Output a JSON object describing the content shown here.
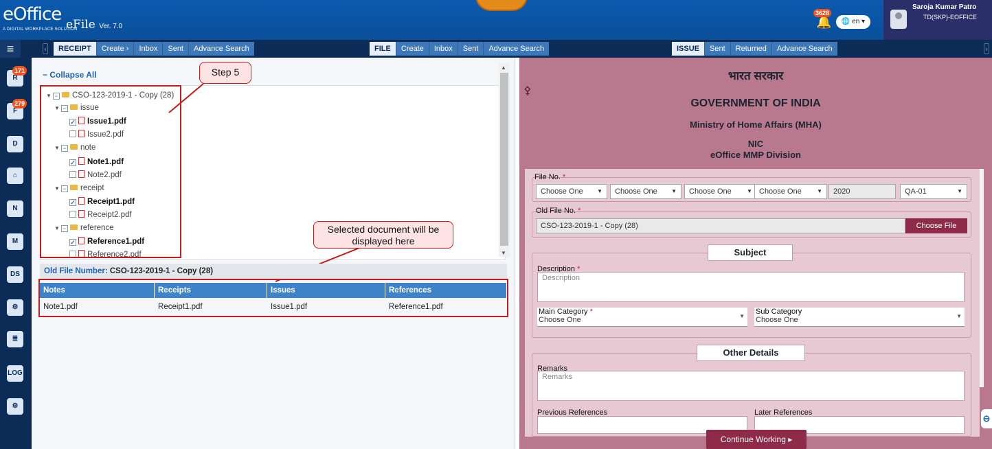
{
  "header": {
    "brand": "eOffice",
    "tagline": "A DIGITAL WORKPLACE SOLUTION",
    "app_name": "eFile",
    "version": "Ver. 7.0",
    "notification_count": "3628",
    "language": "en",
    "user_name": "Saroja Kumar Patro",
    "user_role": "TD(SKP)-EOFFICE"
  },
  "toolbar": {
    "receipt": {
      "title": "RECEIPT",
      "links": [
        "Create ›",
        "Inbox",
        "Sent",
        "Advance Search"
      ]
    },
    "file": {
      "title": "FILE",
      "links": [
        "Create",
        "Inbox",
        "Sent",
        "Advance Search"
      ]
    },
    "issue": {
      "title": "ISSUE",
      "links": [
        "Sent",
        "Returned",
        "Advance Search"
      ]
    }
  },
  "rail": {
    "badges": [
      "171",
      "279"
    ],
    "icons": [
      "receipt-icon",
      "file-icon",
      "dispatch-icon",
      "home-icon",
      "new-icon",
      "transfer-icon",
      "dsc-icon",
      "settings-icon",
      "report-icon",
      "log-icon",
      "admin-icon"
    ]
  },
  "left": {
    "collapse_all": "Collapse All",
    "tree": {
      "root": "CSO-123-2019-1 - Copy (28)",
      "folders": [
        {
          "name": "issue",
          "files": [
            {
              "name": "Issue1.pdf",
              "checked": true
            },
            {
              "name": "Issue2.pdf",
              "checked": false
            }
          ]
        },
        {
          "name": "note",
          "files": [
            {
              "name": "Note1.pdf",
              "checked": true
            },
            {
              "name": "Note2.pdf",
              "checked": false
            }
          ]
        },
        {
          "name": "receipt",
          "files": [
            {
              "name": "Receipt1.pdf",
              "checked": true
            },
            {
              "name": "Receipt2.pdf",
              "checked": false
            }
          ]
        },
        {
          "name": "reference",
          "files": [
            {
              "name": "Reference1.pdf",
              "checked": true
            },
            {
              "name": "Reference2.pdf",
              "checked": false
            }
          ]
        }
      ]
    },
    "callouts": {
      "step": "Step 5",
      "selected": "Selected document will be displayed here"
    },
    "old_file_label": "Old File Number:",
    "old_file_value": "CSO-123-2019-1 - Copy (28)",
    "table": {
      "headers": [
        "Notes",
        "Receipts",
        "Issues",
        "References"
      ],
      "rows": [
        [
          "Note1.pdf",
          "Receipt1.pdf",
          "Issue1.pdf",
          "Reference1.pdf"
        ]
      ]
    }
  },
  "right": {
    "hindi_title": "भारत सरकार",
    "title": "GOVERNMENT OF INDIA",
    "ministry": "Ministry of Home Affairs (MHA)",
    "org": "NIC",
    "division": "eOffice MMP Division",
    "file_no_label": "File No.",
    "file_no_selects": [
      "Choose One",
      "Choose One",
      "Choose One",
      "Choose One"
    ],
    "year": "2020",
    "series": "QA-01",
    "old_file_no_label": "Old File No.",
    "old_file_no_value": "CSO-123-2019-1 - Copy (28)",
    "choose_file": "Choose File",
    "subject_legend": "Subject",
    "description_label": "Description",
    "description_placeholder": "Description",
    "main_category_label": "Main Category",
    "main_category_value": "Choose One",
    "sub_category_label": "Sub Category",
    "sub_category_value": "Choose One",
    "other_details_legend": "Other Details",
    "remarks_label": "Remarks",
    "remarks_placeholder": "Remarks",
    "previous_references_label": "Previous References",
    "later_references_label": "Later References",
    "continue_button": "Continue Working ▸"
  },
  "colors": {
    "header_blue": "#0b5bb0",
    "navy": "#0a2c57",
    "callout_red": "#c21c1c",
    "panel_mauve": "#b8798f",
    "button_maroon": "#8e2a4a"
  }
}
